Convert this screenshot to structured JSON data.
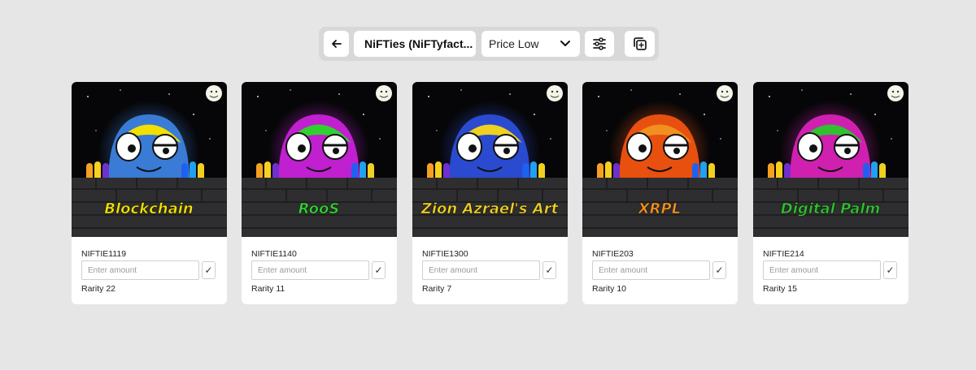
{
  "toolbar": {
    "back_icon": "arrow-left-icon",
    "collection_label": "NiFTies (NiFTyfact...",
    "sort_value": "Price Low",
    "sort_icon": "chevron-down-icon",
    "filter_icon": "sliders-icon",
    "copy_icon": "copy-plus-icon"
  },
  "cards": [
    {
      "name": "NIFTIE1119",
      "placeholder": "Enter amount",
      "confirm": "✓",
      "rarity": "Rarity 22",
      "art_text": "Blockchain",
      "body_color": "#3a7bd5",
      "accent": "#f2e000"
    },
    {
      "name": "NIFTIE1140",
      "placeholder": "Enter amount",
      "confirm": "✓",
      "rarity": "Rarity 11",
      "art_text": "RooS",
      "body_color": "#c020d0",
      "accent": "#30d030"
    },
    {
      "name": "NIFTIE1300",
      "placeholder": "Enter amount",
      "confirm": "✓",
      "rarity": "Rarity 7",
      "art_text": "Zion Azrael's Art",
      "body_color": "#2a4ad0",
      "accent": "#f0d020"
    },
    {
      "name": "NIFTIE203",
      "placeholder": "Enter amount",
      "confirm": "✓",
      "rarity": "Rarity 10",
      "art_text": "XRPL",
      "body_color": "#e85010",
      "accent": "#f09020"
    },
    {
      "name": "NIFTIE214",
      "placeholder": "Enter amount",
      "confirm": "✓",
      "rarity": "Rarity 15",
      "art_text": "Digital Palm",
      "body_color": "#d020b0",
      "accent": "#30c030"
    }
  ],
  "colors": {
    "background": "#e6e6e6",
    "toolbar": "#d8d8d8",
    "card": "#ffffff"
  }
}
